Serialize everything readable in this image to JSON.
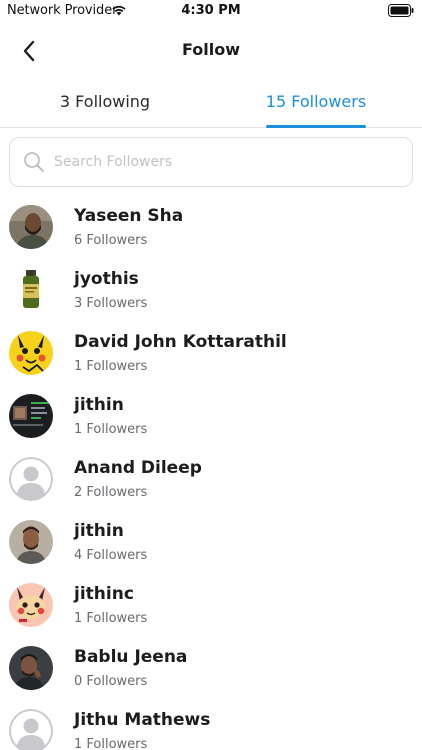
{
  "status_bar": {
    "carrier": "Network Provider",
    "time": "4:30 PM"
  },
  "header": {
    "title": "Follow",
    "back_icon": "chevron-left-icon"
  },
  "tabs": [
    {
      "label": "3 Following",
      "active": false
    },
    {
      "label": "15 Followers",
      "active": true
    }
  ],
  "colors": {
    "accent": "#1e8fe0",
    "text": "#1c1c1e",
    "subtext": "#6a6a70"
  },
  "search": {
    "placeholder": "Search Followers",
    "value": ""
  },
  "followers": [
    {
      "name": "Yaseen Sha",
      "count": "6 Followers",
      "avatar": "photo-man-bearded"
    },
    {
      "name": "jyothis",
      "count": "3 Followers",
      "avatar": "photo-bottle"
    },
    {
      "name": "David John Kottarathil",
      "count": "1 Followers",
      "avatar": "pikachu-yellow"
    },
    {
      "name": "jithin",
      "count": "1 Followers",
      "avatar": "photo-screen-dark"
    },
    {
      "name": "Anand Dileep",
      "count": "2 Followers",
      "avatar": "default-placeholder"
    },
    {
      "name": "jithin",
      "count": "4 Followers",
      "avatar": "photo-man"
    },
    {
      "name": "jithinc",
      "count": "1 Followers",
      "avatar": "pikachu-pink"
    },
    {
      "name": "Bablu Jeena",
      "count": "0 Followers",
      "avatar": "photo-man-dark"
    },
    {
      "name": "Jithu Mathews",
      "count": "1 Followers",
      "avatar": "default-placeholder"
    }
  ]
}
